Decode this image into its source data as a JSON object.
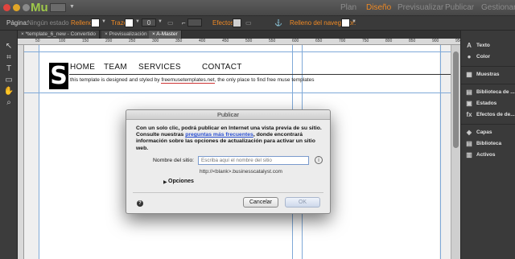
{
  "app": {
    "logo": "Mu",
    "modes": [
      "Plan",
      "Diseño",
      "Previsualizar",
      "Publicar",
      "Gestionar"
    ],
    "active_mode": "Diseño"
  },
  "controlbar": {
    "page_label": "Página:",
    "page_value": "Ningún estado",
    "fill_label": "Relleno:",
    "stroke_label": "Trazo",
    "stroke_value": "0",
    "effects_label": "Efectos:",
    "browser_fill_label": "Relleno del navegador:",
    "accent": "#f08a24"
  },
  "tabs": [
    "*template_6_new - Convertido",
    "Previsualización",
    "A-Master"
  ],
  "ruler_ticks": [
    "50",
    "100",
    "150",
    "200",
    "250",
    "300",
    "350",
    "400",
    "450",
    "500",
    "550",
    "600",
    "650",
    "700",
    "750",
    "800",
    "850",
    "900",
    "950"
  ],
  "site": {
    "logo_letter": "S",
    "nav": [
      "HOME",
      "TEAM",
      "SERVICES",
      "CONTACT"
    ],
    "tagline_pre": "this template is designed and styled by ",
    "tagline_link": "freemusetemplates.net",
    "tagline_post": ", the only place to find free muse templates"
  },
  "panel": {
    "items": [
      "Texto",
      "Color",
      "Muestras",
      "Biblioteca de ...",
      "Estados",
      "Efectos de de...",
      "Capas",
      "Biblioteca",
      "Activos"
    ],
    "icons": [
      "text-icon",
      "color-icon",
      "swatches-icon",
      "library-icon",
      "states-icon",
      "effects-icon",
      "layers-icon",
      "library-icon",
      "assets-icon"
    ]
  },
  "dialog": {
    "title": "Publicar",
    "msg_1": "Con un solo clic, podrá publicar en Internet una vista previa de su sitio. Consulte nuestras ",
    "msg_link": "preguntas más frecuentes",
    "msg_2": ", donde encontrará información sobre las opciones de actualización para activar un sitio web.",
    "site_label": "Nombre del sitio:",
    "site_placeholder": "Escriba aquí el nombre del sitio",
    "url_preview": "http://<blank>.businesscatalyst.com",
    "options_label": "Opciones",
    "cancel_label": "Cancelar",
    "ok_label": "OK"
  }
}
